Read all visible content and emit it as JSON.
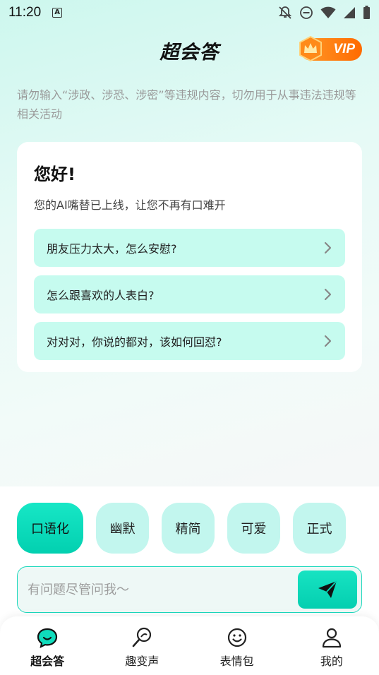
{
  "status": {
    "time": "11:20",
    "app_indicator": "A"
  },
  "header": {
    "title": "超会答",
    "vip_label": "VIP"
  },
  "notice": "请勿输入“涉政、涉恐、涉密”等违规内容，切勿用于从事违法违规等相关活动",
  "card": {
    "title": "您好!",
    "subtitle": "您的AI嘴替已上线，让您不再有口难开",
    "suggestions": [
      "朋友压力太大，怎么安慰?",
      "怎么跟喜欢的人表白?",
      "对对对，你说的都对，该如何回怼?"
    ]
  },
  "styles": [
    "口语化",
    "幽默",
    "精简",
    "可爱",
    "正式"
  ],
  "input": {
    "placeholder": "有问题尽管问我～"
  },
  "tabs": [
    {
      "label": "超会答",
      "icon": "chat-bubble-icon"
    },
    {
      "label": "趣变声",
      "icon": "voice-changer-icon"
    },
    {
      "label": "表情包",
      "icon": "smiley-icon"
    },
    {
      "label": "我的",
      "icon": "person-icon"
    }
  ],
  "colors": {
    "accent": "#0fdcbc",
    "suggestion_bg": "#c6fbef",
    "chip_bg": "#c2f6ee",
    "vip": "#ff7d12"
  }
}
